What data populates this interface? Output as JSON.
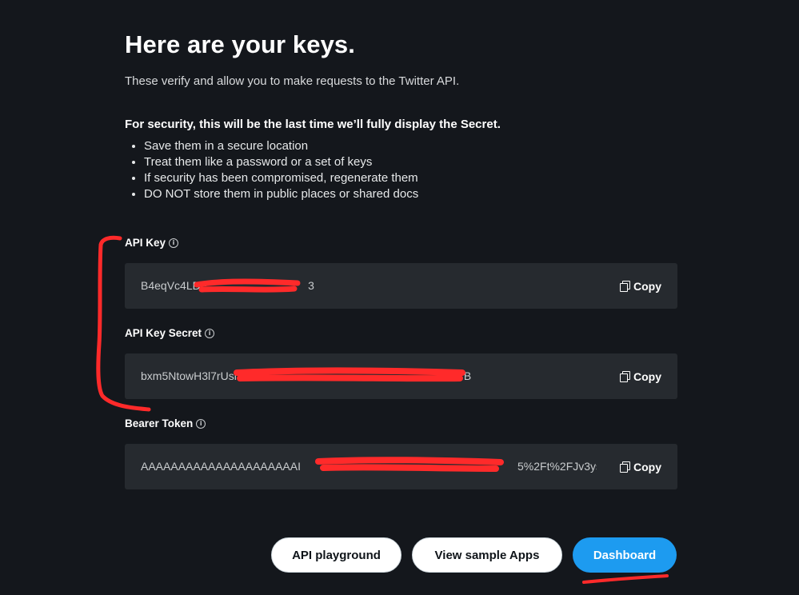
{
  "header": {
    "title": "Here are your keys.",
    "subtitle": "These verify and allow you to make requests to the Twitter API."
  },
  "security": {
    "title": "For security, this will be the last time we’ll fully display the Secret.",
    "bullets": [
      "Save them in a secure location",
      "Treat them like a password or a set of keys",
      "If security has been compromised, regenerate them",
      "DO NOT store them in public places or shared docs"
    ]
  },
  "keys": {
    "api_key": {
      "label": "API Key",
      "value": "B4eqVc4LDP",
      "value_tail": "3",
      "copy_label": "Copy"
    },
    "api_key_secret": {
      "label": "API Key Secret",
      "value": "bxm5NtowH3l7rUsl",
      "value_tail": "B",
      "copy_label": "Copy"
    },
    "bearer_token": {
      "label": "Bearer Token",
      "value": "AAAAAAAAAAAAAAAAAAAAAI",
      "value_tail": "5%2Ft%2FJv3ys…",
      "copy_label": "Copy"
    }
  },
  "actions": {
    "playground_label": "API playground",
    "samples_label": "View sample Apps",
    "dashboard_label": "Dashboard"
  },
  "icons": {
    "info": "info-icon",
    "copy": "copy-icon"
  },
  "colors": {
    "background": "#14171c",
    "field_bg": "#262a2f",
    "primary": "#1d9bf0",
    "annotation": "#ff2a2a"
  }
}
